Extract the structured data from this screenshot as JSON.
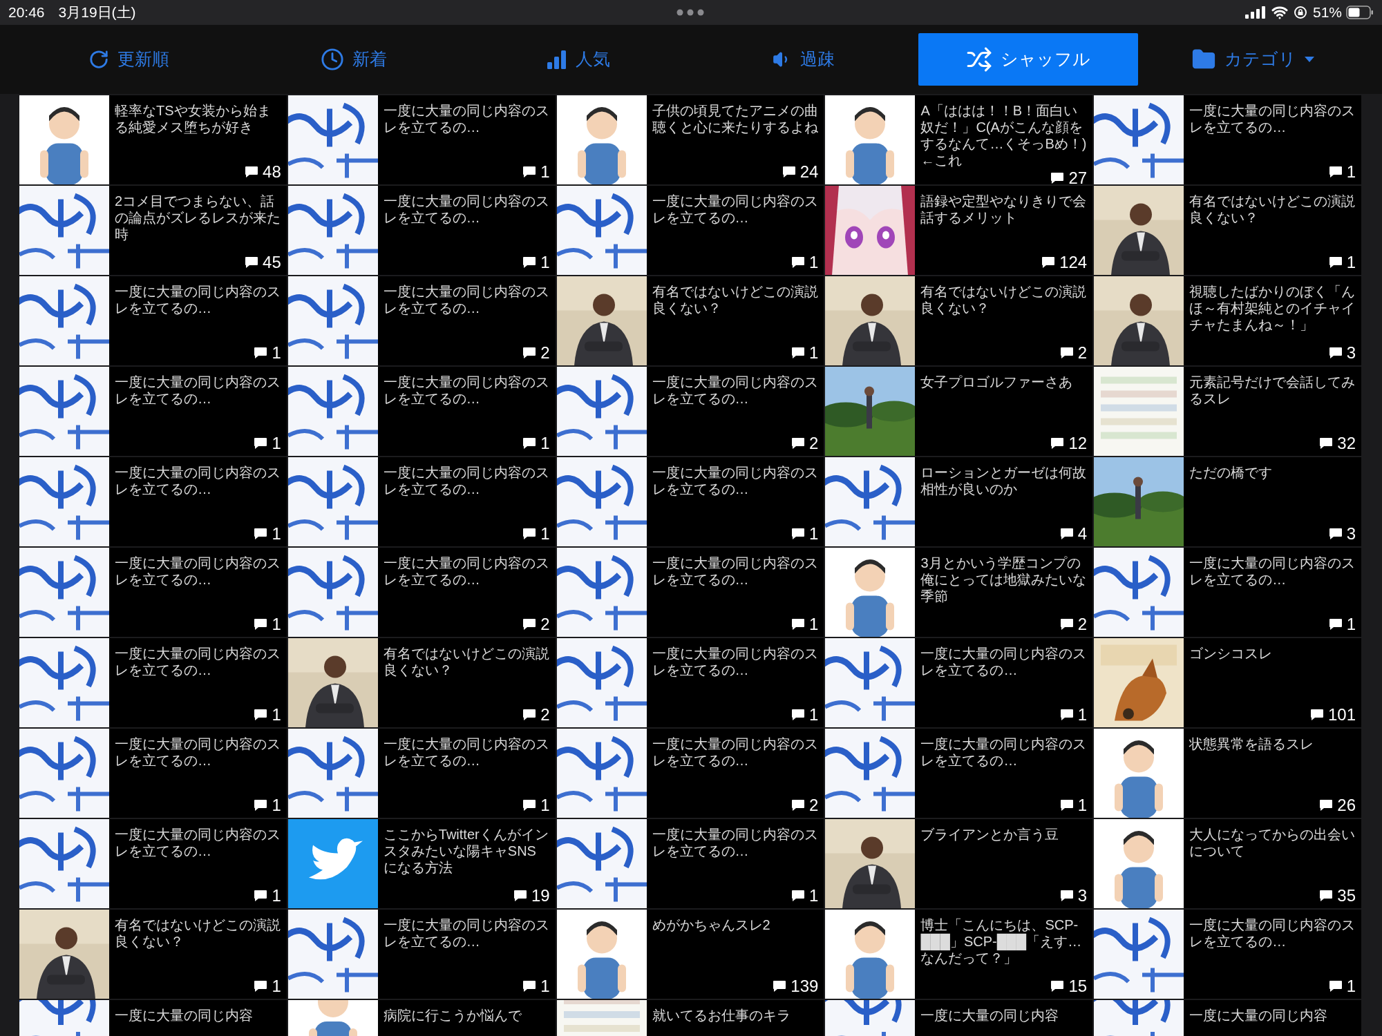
{
  "status_bar": {
    "time": "20:46",
    "date": "3月19日(土)",
    "battery": "51%"
  },
  "tabs": [
    {
      "label": "更新順",
      "kind": "sort",
      "selected": false
    },
    {
      "label": "新着",
      "kind": "sort",
      "selected": false
    },
    {
      "label": "人気",
      "kind": "sort",
      "selected": false
    },
    {
      "label": "過疎",
      "kind": "sort",
      "selected": false
    },
    {
      "label": "シャッフル",
      "kind": "sort",
      "selected": true
    },
    {
      "label": "カテゴリ",
      "kind": "dropdown",
      "selected": false
    }
  ],
  "threads": [
    {
      "title": "軽率なTSや女装から始まる純愛メス堕ちが好き",
      "count": "48"
    },
    {
      "title": "一度に大量の同じ内容のスレを立てるの…",
      "count": "1"
    },
    {
      "title": "子供の頃見てたアニメの曲聴くと心に来たりするよね",
      "count": "24"
    },
    {
      "title": "A「ははは！！B！面白い奴だ！」C(Aがこんな顔をするなんて…くそっBめ！)←これ",
      "count": "27"
    },
    {
      "title": "一度に大量の同じ内容のスレを立てるの…",
      "count": "1"
    },
    {
      "title": "2コメ目でつまらない、話の論点がズレるレスが来た時",
      "count": "45"
    },
    {
      "title": "一度に大量の同じ内容のスレを立てるの…",
      "count": "1"
    },
    {
      "title": "一度に大量の同じ内容のスレを立てるの…",
      "count": "1"
    },
    {
      "title": "語録や定型やなりきりで会話するメリット",
      "count": "124"
    },
    {
      "title": "有名ではないけどこの演説良くない？",
      "count": "1"
    },
    {
      "title": "一度に大量の同じ内容のスレを立てるの…",
      "count": "1"
    },
    {
      "title": "一度に大量の同じ内容のスレを立てるの…",
      "count": "2"
    },
    {
      "title": "有名ではないけどこの演説良くない？",
      "count": "1"
    },
    {
      "title": "有名ではないけどこの演説良くない？",
      "count": "2"
    },
    {
      "title": "視聴したばかりのぼく「んほ～有村架純とのイチャイチャたまんね～！」",
      "count": "3"
    },
    {
      "title": "一度に大量の同じ内容のスレを立てるの…",
      "count": "1"
    },
    {
      "title": "一度に大量の同じ内容のスレを立てるの…",
      "count": "1"
    },
    {
      "title": "一度に大量の同じ内容のスレを立てるの…",
      "count": "2"
    },
    {
      "title": "女子プロゴルファーさあ",
      "count": "12"
    },
    {
      "title": "元素記号だけで会話してみるスレ",
      "count": "32"
    },
    {
      "title": "一度に大量の同じ内容のスレを立てるの…",
      "count": "1"
    },
    {
      "title": "一度に大量の同じ内容のスレを立てるの…",
      "count": "1"
    },
    {
      "title": "一度に大量の同じ内容のスレを立てるの…",
      "count": "1"
    },
    {
      "title": "ローションとガーゼは何故相性が良いのか",
      "count": "4"
    },
    {
      "title": "ただの橋です",
      "count": "3"
    },
    {
      "title": "一度に大量の同じ内容のスレを立てるの…",
      "count": "1"
    },
    {
      "title": "一度に大量の同じ内容のスレを立てるの…",
      "count": "2"
    },
    {
      "title": "一度に大量の同じ内容のスレを立てるの…",
      "count": "1"
    },
    {
      "title": "3月とかいう学歴コンプの俺にとっては地獄みたいな季節",
      "count": "2"
    },
    {
      "title": "一度に大量の同じ内容のスレを立てるの…",
      "count": "1"
    },
    {
      "title": "一度に大量の同じ内容のスレを立てるの…",
      "count": "1"
    },
    {
      "title": "有名ではないけどこの演説良くない？",
      "count": "2"
    },
    {
      "title": "一度に大量の同じ内容のスレを立てるの…",
      "count": "1"
    },
    {
      "title": "一度に大量の同じ内容のスレを立てるの…",
      "count": "1"
    },
    {
      "title": "ゴンシコスレ",
      "count": "101"
    },
    {
      "title": "一度に大量の同じ内容のスレを立てるの…",
      "count": "1"
    },
    {
      "title": "一度に大量の同じ内容のスレを立てるの…",
      "count": "1"
    },
    {
      "title": "一度に大量の同じ内容のスレを立てるの…",
      "count": "2"
    },
    {
      "title": "一度に大量の同じ内容のスレを立てるの…",
      "count": "1"
    },
    {
      "title": "状態異常を語るスレ",
      "count": "26"
    },
    {
      "title": "一度に大量の同じ内容のスレを立てるの…",
      "count": "1"
    },
    {
      "title": "ここからTwitterくんがインスタみたいな陽キャSNSになる方法",
      "count": "19"
    },
    {
      "title": "一度に大量の同じ内容のスレを立てるの…",
      "count": "1"
    },
    {
      "title": "ブライアンとか言う豆",
      "count": "3"
    },
    {
      "title": "大人になってからの出会いについて",
      "count": "35"
    },
    {
      "title": "有名ではないけどこの演説良くない？",
      "count": "1"
    },
    {
      "title": "一度に大量の同じ内容のスレを立てるの…",
      "count": "1"
    },
    {
      "title": "めがかちゃんスレ2",
      "count": "139"
    },
    {
      "title": "博士「こんにちは、SCP-███」SCP-███「えす…なんだって？」",
      "count": "15"
    },
    {
      "title": "一度に大量の同じ内容のスレを立てるの…",
      "count": "1"
    },
    {
      "title": "一度に大量の同じ内容"
    },
    {
      "title": "病院に行こうか悩んで"
    },
    {
      "title": "就いてるお仕事のキラ"
    },
    {
      "title": "一度に大量の同じ内容"
    },
    {
      "title": "一度に大量の同じ内容"
    }
  ]
}
